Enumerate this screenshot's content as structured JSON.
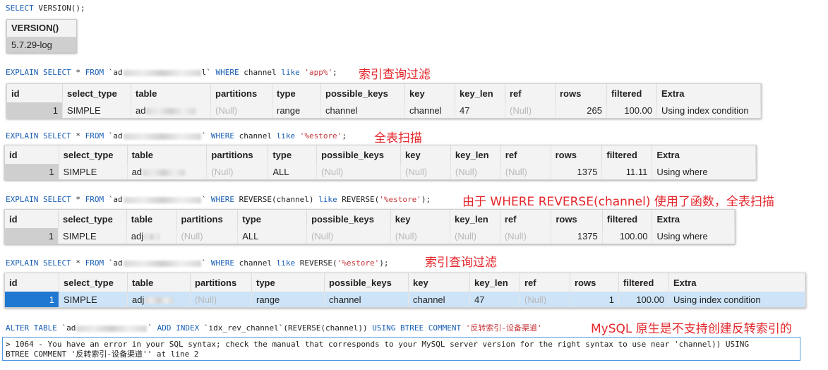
{
  "q1": {
    "kw1": "SELECT",
    "fn": "VERSION",
    "rest": "();"
  },
  "version_grid": {
    "header": "VERSION()",
    "value": "5.7.29-log"
  },
  "q2": {
    "p1": "EXPLAIN SELECT",
    "p2": " * ",
    "p3": "FROM",
    "tbl_a": " `ad",
    "tbl_b": "l`",
    "p4": " WHERE",
    "p5": " channel ",
    "p6": "like",
    "p7": " ",
    "lit": "'app%'",
    "p8": ";"
  },
  "note2": "索引查询过滤",
  "grid2": {
    "headers": [
      "id",
      "select_type",
      "table",
      "partitions",
      "type",
      "possible_keys",
      "key",
      "key_len",
      "ref",
      "rows",
      "filtered",
      "Extra"
    ],
    "row": {
      "id": "1",
      "select_type": "SIMPLE",
      "table": "ad",
      "partitions": "(Null)",
      "type": "range",
      "possible_keys": "channel",
      "key": "channel",
      "key_len": "47",
      "ref": "(Null)",
      "rows": "265",
      "filtered": "100.00",
      "extra": "Using index condition"
    }
  },
  "q3": {
    "p1": "EXPLAIN SELECT",
    "p2": " * ",
    "p3": "FROM",
    "tbl_a": " `ad",
    "tbl_b": "`",
    "p4": " WHERE",
    "p5": " channel ",
    "p6": "like",
    "p7": " ",
    "lit": "'%estore'",
    "p8": ";"
  },
  "note3": "全表扫描",
  "grid3": {
    "headers": [
      "id",
      "select_type",
      "table",
      "partitions",
      "type",
      "possible_keys",
      "key",
      "key_len",
      "ref",
      "rows",
      "filtered",
      "Extra"
    ],
    "row": {
      "id": "1",
      "select_type": "SIMPLE",
      "table": "ad",
      "partitions": "(Null)",
      "type": "ALL",
      "possible_keys": "(Null)",
      "key": "(Null)",
      "key_len": "(Null)",
      "ref": "(Null)",
      "rows": "1375",
      "filtered": "11.11",
      "extra": "Using where"
    }
  },
  "q4": {
    "p1": "EXPLAIN SELECT",
    "p2": " * ",
    "p3": "FROM",
    "tbl_a": " `ad",
    "tbl_b": "`",
    "p4": " WHERE",
    "p5": " REVERSE(channel) ",
    "p6": "like",
    "p7": " REVERSE(",
    "lit": "'%estore'",
    "p8": ");"
  },
  "note4": "由于 WHERE REVERSE(channel) 使用了函数，全表扫描",
  "grid4": {
    "headers": [
      "id",
      "select_type",
      "table",
      "partitions",
      "type",
      "possible_keys",
      "key",
      "key_len",
      "ref",
      "rows",
      "filtered",
      "Extra"
    ],
    "row": {
      "id": "1",
      "select_type": "SIMPLE",
      "table": "adj",
      "partitions": "(Null)",
      "type": "ALL",
      "possible_keys": "(Null)",
      "key": "(Null)",
      "key_len": "(Null)",
      "ref": "(Null)",
      "rows": "1375",
      "filtered": "100.00",
      "extra": "Using where"
    }
  },
  "q5": {
    "p1": "EXPLAIN SELECT",
    "p2": " * ",
    "p3": "FROM",
    "tbl_a": " `ad",
    "tbl_b": "`",
    "p4": " WHERE",
    "p5": " channel ",
    "p6": "like",
    "p7": " REVERSE(",
    "lit": "'%estore'",
    "p8": ");"
  },
  "note5": "索引查询过滤",
  "grid5": {
    "headers": [
      "id",
      "select_type",
      "table",
      "partitions",
      "type",
      "possible_keys",
      "key",
      "key_len",
      "ref",
      "rows",
      "filtered",
      "Extra"
    ],
    "row": {
      "id": "1",
      "select_type": "SIMPLE",
      "table": "adj",
      "partitions": "(Null)",
      "type": "range",
      "possible_keys": "channel",
      "key": "channel",
      "key_len": "47",
      "ref": "(Null)",
      "rows": "1",
      "filtered": "100.00",
      "extra": "Using index condition"
    }
  },
  "q6": {
    "p1": "ALTER TABLE",
    "tbl_a": " `ad",
    "tbl_b": "`",
    "p2": " ADD INDEX",
    "p3": " `idx_rev_channel`(REVERSE(channel)) ",
    "p4": "USING BTREE COMMENT",
    "p5": " ",
    "lit": "'反转索引-设备渠道'"
  },
  "note6": "MySQL 原生是不支持创建反转索引的",
  "error": {
    "line1": "> 1064 - You have an error in your SQL syntax; check the manual that corresponds to your MySQL server version for the right syntax to use near 'channel)) USING",
    "line2": "BTREE COMMENT '反转索引-设备渠道'' at line 2"
  },
  "colors": {
    "keyword": "#1a5fb4",
    "string": "#c8373b",
    "note": "#e4262b",
    "selected_row": "#cde3f7",
    "selected_id": "#1f78d1"
  }
}
